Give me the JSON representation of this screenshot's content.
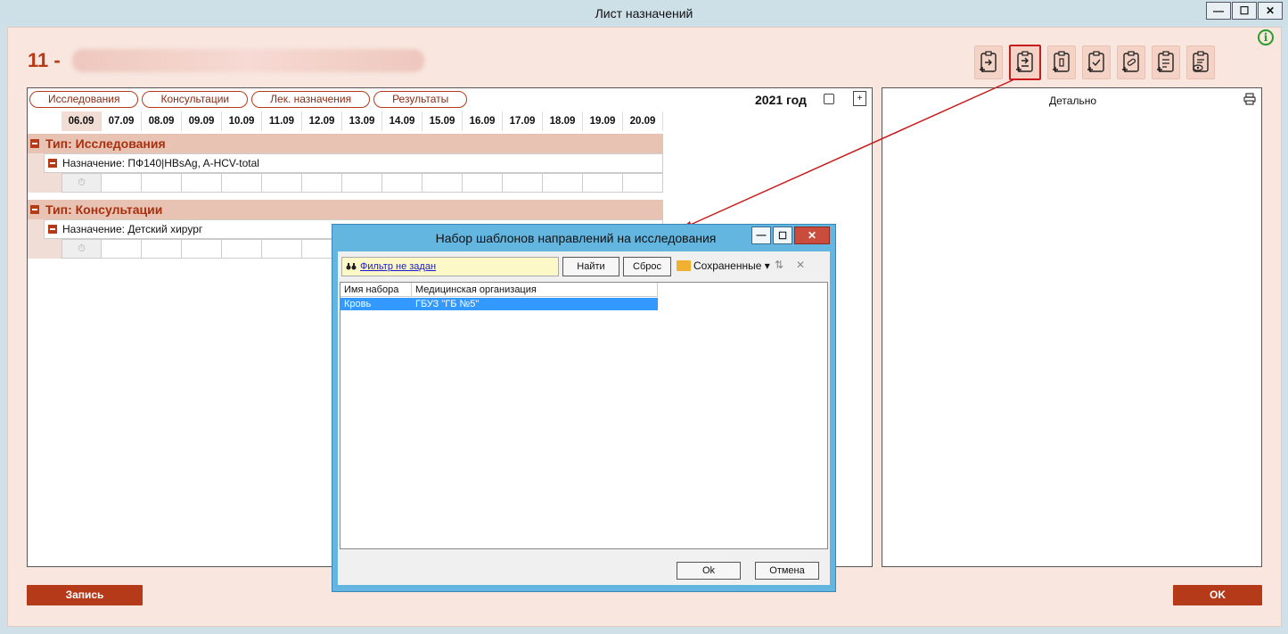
{
  "window": {
    "title": "Лист назначений",
    "minimize": "—",
    "maximize": "☐",
    "close": "✕"
  },
  "header": {
    "patient_prefix": "11 -",
    "info_icon": "i"
  },
  "tabs": [
    "Исследования",
    "Консультации",
    "Лек. назначения",
    "Результаты"
  ],
  "year": "2021 год",
  "dates": [
    "06.09",
    "07.09",
    "08.09",
    "09.09",
    "10.09",
    "11.09",
    "12.09",
    "13.09",
    "14.09",
    "15.09",
    "16.09",
    "17.09",
    "18.09",
    "19.09",
    "20.09"
  ],
  "groups": [
    {
      "type_label": "Тип: Исследования",
      "assignment": "Назначение: ПФ140|HBsAg, A-HCV-total"
    },
    {
      "type_label": "Тип: Консультации",
      "assignment": "Назначение: Детский хирург"
    }
  ],
  "detail_panel": {
    "title": "Детально"
  },
  "buttons": {
    "write": "Запись",
    "ok": "OK"
  },
  "dialog": {
    "title": "Набор шаблонов направлений на исследования",
    "filter": "Фильтр не задан",
    "find": "Найти",
    "reset": "Сброс",
    "saved": "Сохраненные ▾",
    "close_small": "✕",
    "columns": [
      "Имя набора",
      "Медицинская организация"
    ],
    "rows": [
      {
        "name": "Кровь",
        "org": "ГБУЗ \"ГБ №5\""
      }
    ],
    "ok": "Ok",
    "cancel": "Отмена"
  }
}
